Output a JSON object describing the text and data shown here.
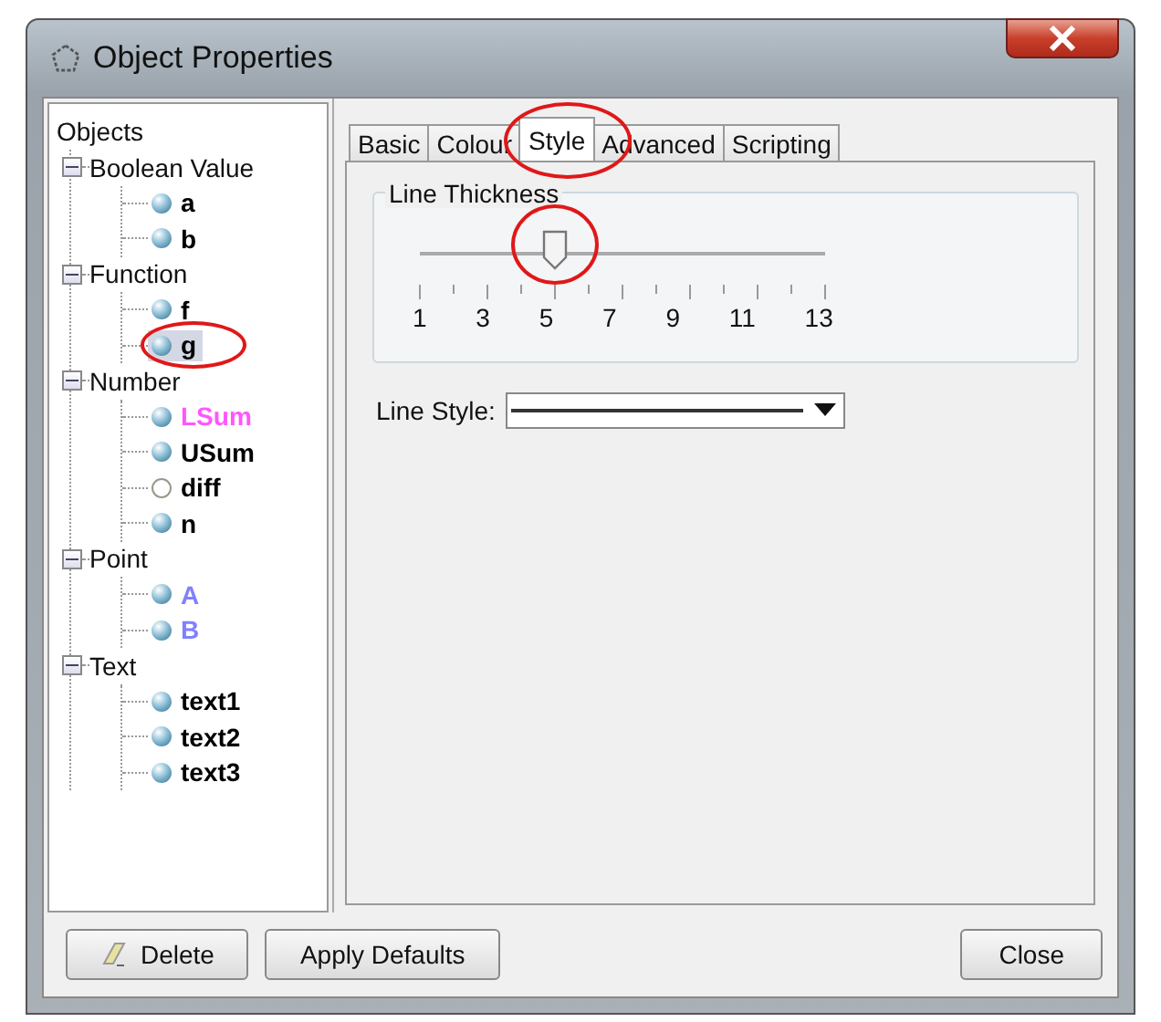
{
  "window": {
    "title": "Object Properties"
  },
  "tree": {
    "root": "Objects",
    "categories": [
      {
        "label": "Boolean Value",
        "expanded": true,
        "children": [
          {
            "label": "a",
            "shown": true,
            "selected": false,
            "color": "#000000",
            "highlighted": false
          },
          {
            "label": "b",
            "shown": true,
            "selected": false,
            "color": "#000000",
            "highlighted": false
          }
        ]
      },
      {
        "label": "Function",
        "expanded": true,
        "children": [
          {
            "label": "f",
            "shown": true,
            "selected": false,
            "color": "#000000",
            "highlighted": false
          },
          {
            "label": "g",
            "shown": true,
            "selected": true,
            "color": "#000000",
            "highlighted": true
          }
        ]
      },
      {
        "label": "Number",
        "expanded": true,
        "children": [
          {
            "label": "LSum",
            "shown": true,
            "selected": false,
            "color": "#ff55ff",
            "highlighted": false
          },
          {
            "label": "USum",
            "shown": true,
            "selected": false,
            "color": "#000000",
            "highlighted": false
          },
          {
            "label": "diff",
            "shown": false,
            "selected": false,
            "color": "#000000",
            "highlighted": false
          },
          {
            "label": "n",
            "shown": true,
            "selected": false,
            "color": "#000000",
            "highlighted": false
          }
        ]
      },
      {
        "label": "Point",
        "expanded": true,
        "children": [
          {
            "label": "A",
            "shown": true,
            "selected": false,
            "color": "#8080ff",
            "highlighted": false
          },
          {
            "label": "B",
            "shown": true,
            "selected": false,
            "color": "#8080ff",
            "highlighted": false
          }
        ]
      },
      {
        "label": "Text",
        "expanded": true,
        "children": [
          {
            "label": "text1",
            "shown": true,
            "selected": false,
            "color": "#000000",
            "highlighted": false
          },
          {
            "label": "text2",
            "shown": true,
            "selected": false,
            "color": "#000000",
            "highlighted": false
          },
          {
            "label": "text3",
            "shown": true,
            "selected": false,
            "color": "#000000",
            "highlighted": false
          }
        ]
      }
    ]
  },
  "tabs": [
    {
      "label": "Basic",
      "selected": false,
      "highlighted": false
    },
    {
      "label": "Colour",
      "selected": false,
      "highlighted": false
    },
    {
      "label": "Style",
      "selected": true,
      "highlighted": true
    },
    {
      "label": "Advanced",
      "selected": false,
      "highlighted": false
    },
    {
      "label": "Scripting",
      "selected": false,
      "highlighted": false
    }
  ],
  "line_thickness": {
    "title": "Line Thickness",
    "level": 0.333,
    "highlighted": true,
    "scale": "1 3 5 7 9 11 13"
  },
  "line_style": {
    "label": "Line Style:"
  },
  "buttons": {
    "left": [
      {
        "label": "Delete",
        "kind": "eraser"
      },
      {
        "label": "Apply Defaults",
        "kind": "plain"
      }
    ],
    "right": [
      {
        "label": "Close"
      }
    ]
  }
}
